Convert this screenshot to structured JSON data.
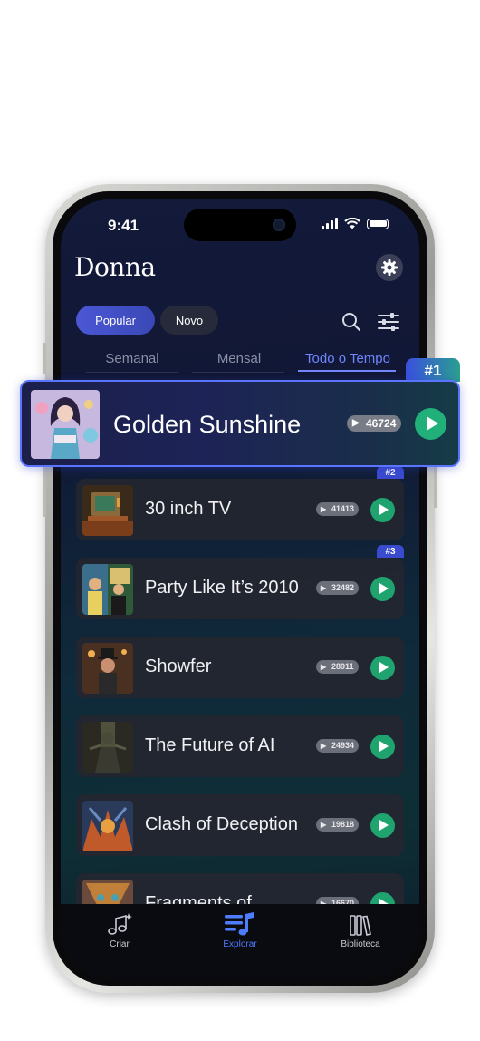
{
  "status_bar": {
    "time": "9:41"
  },
  "app": {
    "title": "Donna"
  },
  "filters": {
    "popular": "Popular",
    "novo": "Novo"
  },
  "tabs": [
    {
      "label": "Semanal"
    },
    {
      "label": "Mensal"
    },
    {
      "label": "Todo o Tempo",
      "active": true
    }
  ],
  "featured": {
    "rank": "#1",
    "title": "Golden Sunshine",
    "plays": "46724"
  },
  "tracks": [
    {
      "rank": "#2",
      "title": "30 inch TV",
      "plays": "41413"
    },
    {
      "rank": "#3",
      "title": "Party Like It’s 2010",
      "plays": "32482"
    },
    {
      "title": "Showfer",
      "plays": "28911"
    },
    {
      "title": "The Future of AI",
      "plays": "24934"
    },
    {
      "title": "Clash of Deception",
      "plays": "19818"
    },
    {
      "title": "Fragments of",
      "plays": "16670"
    }
  ],
  "tab_bar": {
    "criar": "Criar",
    "explorar": "Explorar",
    "biblioteca": "Biblioteca"
  },
  "colors": {
    "accent": "#5b74ff",
    "play_green": "#1fa46f",
    "active_tab": "#4e7cff"
  },
  "icons": [
    "gear-icon",
    "search-icon",
    "filter-sliders-icon",
    "play-icon",
    "music-note-sparkle-icon",
    "list-music-icon",
    "library-icon"
  ]
}
